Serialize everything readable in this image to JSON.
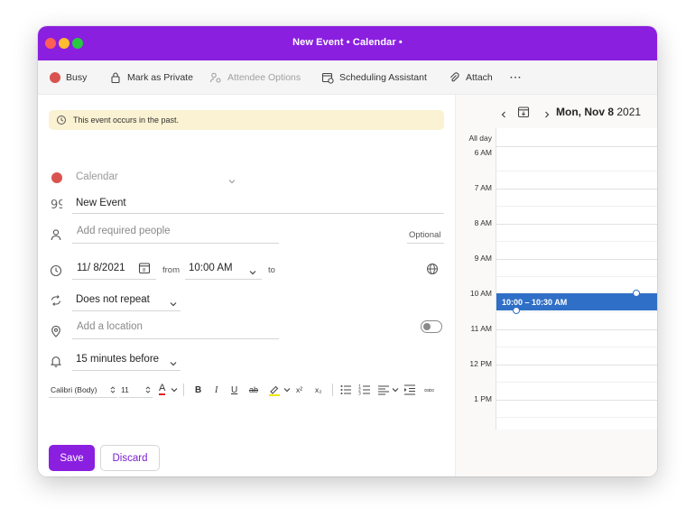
{
  "window": {
    "title": "New Event • Calendar •"
  },
  "toolbar": {
    "busy": "Busy",
    "mark_private": "Mark as Private",
    "attendee_options": "Attendee Options",
    "scheduling_assistant": "Scheduling Assistant",
    "attach": "Attach",
    "more": "···"
  },
  "banner": {
    "text": "This event occurs in the past."
  },
  "form": {
    "calendar_placeholder": "Calendar",
    "title_value": "New Event",
    "people_placeholder": "Add required people",
    "optional_label": "Optional",
    "date_value": "11/  8/2021",
    "from_label": "from",
    "start_time": "10:00 AM",
    "to_label": "to",
    "repeat_value": "Does not repeat",
    "location_placeholder": "Add a location",
    "reminder_value": "15 minutes before"
  },
  "format": {
    "font_name": "Calibri (Body)",
    "font_size": "11",
    "font_color_glyph": "A",
    "bold": "B",
    "italic": "I",
    "underline": "U",
    "strike": "ab",
    "superscript": "x²",
    "subscript": "x₂",
    "more": "∞∞"
  },
  "buttons": {
    "save": "Save",
    "discard": "Discard"
  },
  "calendar_pane": {
    "day_label": "Mon, Nov 8",
    "year": "2021",
    "all_day": "All day",
    "hours": [
      "6 AM",
      "7 AM",
      "8 AM",
      "9 AM",
      "10 AM",
      "11 AM",
      "12 PM",
      "1 PM"
    ],
    "event_time": "10:00 – 10:30 AM"
  },
  "colors": {
    "accent": "#8a1fe0",
    "busy": "#d9534f",
    "event": "#2f6fc7",
    "banner": "#fbf2d3"
  }
}
